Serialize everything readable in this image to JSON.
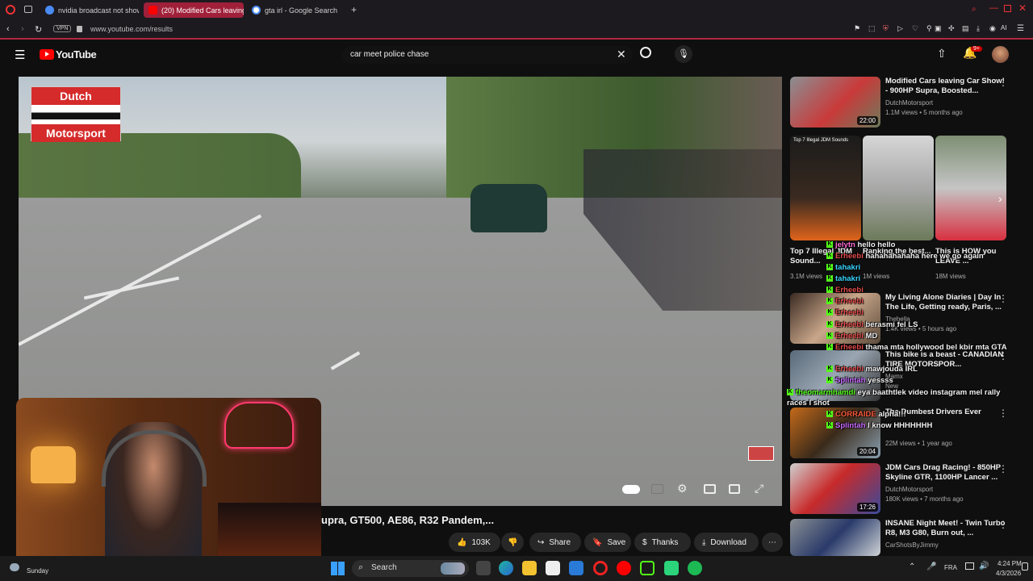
{
  "browser": {
    "tabs": [
      {
        "label": "nvidia broadcast not show",
        "active": false
      },
      {
        "label": "(20) Modified Cars leaving",
        "active": true
      },
      {
        "label": "gta irl - Google Search",
        "active": false
      }
    ],
    "new_tab": "+",
    "vpn": "VPN",
    "url": "www.youtube.com/results",
    "ai_label": "AI"
  },
  "youtube": {
    "logo_text": "YouTube",
    "search_value": "car meet police chase",
    "notif_badge": "9+",
    "video": {
      "overlay_logo_top": "Dutch",
      "overlay_logo_bottom": "Motorsport",
      "title_partial": "upra, GT500, AE86, R32 Pandem,...",
      "likes": "103K",
      "share": "Share",
      "save": "Save",
      "thanks": "Thanks",
      "download": "Download"
    },
    "recommendations": [
      {
        "title": "Modified Cars leaving Car Show! - 900HP Supra, Boosted...",
        "channel": "DutchMotorsport",
        "meta": "1.1M views • 5 months ago",
        "duration": "22:00"
      },
      {
        "title": "My Living Alone Diaries | Day In The Life, Getting ready, Paris, ...",
        "channel": "Thebella",
        "meta": "1.4K views • 5 hours ago",
        "duration": ""
      },
      {
        "title": "This bike is a beast - CANADIAN TIRE MOTORSPOR...",
        "channel": "Mamx",
        "meta": "New",
        "duration": ""
      },
      {
        "title": "The Dumbest Drivers Ever",
        "channel": "",
        "meta": "22M views • 1 year ago",
        "duration": "20:04"
      },
      {
        "title": "JDM Cars Drag Racing! - 850HP Skyline GTR, 1100HP Lancer ...",
        "channel": "DutchMotorsport",
        "meta": "180K views • 7 months ago",
        "duration": "17:26"
      },
      {
        "title": "INSANE Night Meet! - Twin Turbo R8, M3 G80, Burn out, ...",
        "channel": "CarShotsByJimmy",
        "meta": "",
        "duration": ""
      }
    ],
    "shorts": [
      {
        "title": "Top 7 Illegal JDM Sound...",
        "views": "3.1M views"
      },
      {
        "title": "Ranking the best...",
        "views": "1M views"
      },
      {
        "title": "This is HOW you LEAVE ...",
        "views": "18M views"
      }
    ],
    "shorts_thumb_text": "Top 7 Illegal JDM Sounds"
  },
  "chat": [
    {
      "user": "jelytn",
      "msg": "hello hello",
      "color": "#ff6bd6"
    },
    {
      "user": "Erheebi",
      "msg": "hahahahahaha here we go again",
      "color": "#e24a4a"
    },
    {
      "user": "tahakri",
      "msg": "",
      "color": "#39d5ff"
    },
    {
      "user": "tahakri",
      "msg": "",
      "color": "#39d5ff"
    },
    {
      "user": "Erheebi",
      "msg": "",
      "color": "#e24a4a"
    },
    {
      "user": "Erheebi",
      "msg": "",
      "color": "#e24a4a"
    },
    {
      "user": "Erheebi",
      "msg": "",
      "color": "#e24a4a"
    },
    {
      "user": "Erheebi",
      "msg": "berasmi fel LS",
      "color": "#e24a4a"
    },
    {
      "user": "Erheebi",
      "msg": "MD",
      "color": "#e24a4a"
    },
    {
      "user": "Erheebi",
      "msg": "thama mta hollywood bel kbir mta GTA",
      "color": "#e24a4a"
    },
    {
      "user": "Erheebi",
      "msg": "mawjouda IRL",
      "color": "#e24a4a"
    },
    {
      "user": "Splintah",
      "msg": "yessss",
      "color": "#c86bff"
    },
    {
      "user": "theomarmhamdi",
      "msg": "eya baathtlek video instagram mel rally races I shot",
      "color": "#53fc18"
    },
    {
      "user": "CORRAIDE",
      "msg": "alpha!!!",
      "color": "#ff5a3c"
    },
    {
      "user": "Splintah",
      "msg": "I know HHHHHHH",
      "color": "#c86bff"
    }
  ],
  "taskbar": {
    "search": "Search",
    "weather_day": "Sunday",
    "lang": "FRA",
    "time": "4:24 PM",
    "date": "4/3/2026"
  },
  "colors": {
    "accent": "#b3263f",
    "yt_red": "#ff0000",
    "kick_green": "#53fc18"
  }
}
